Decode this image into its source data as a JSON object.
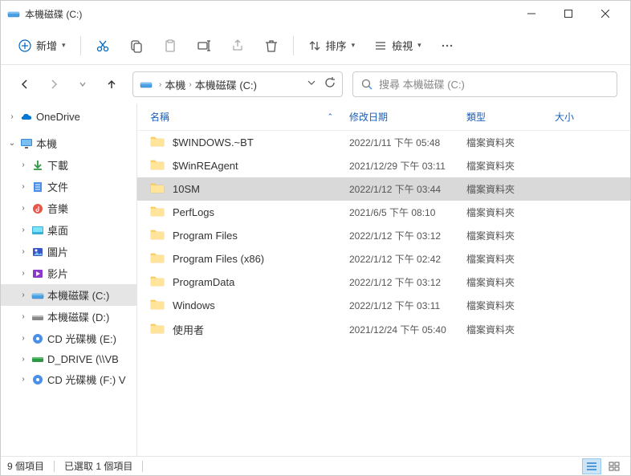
{
  "window": {
    "title": "本機磁碟 (C:)"
  },
  "toolbar": {
    "new": "新增",
    "sort": "排序",
    "view": "檢視"
  },
  "breadcrumb": {
    "items": [
      "本機",
      "本機磁碟 (C:)"
    ]
  },
  "search": {
    "placeholder": "搜尋 本機磁碟 (C:)"
  },
  "sidebar": {
    "onedrive": "OneDrive",
    "thispc": "本機",
    "downloads": "下載",
    "documents": "文件",
    "music": "音樂",
    "desktop": "桌面",
    "pictures": "圖片",
    "videos": "影片",
    "drive_c": "本機磁碟 (C:)",
    "drive_d": "本機磁碟 (D:)",
    "cd_e": "CD 光碟機 (E:)",
    "d_drive": "D_DRIVE (\\\\VB",
    "cd_f": "CD 光碟機 (F:) V"
  },
  "columns": {
    "name": "名稱",
    "date": "修改日期",
    "type": "類型",
    "size": "大小"
  },
  "files": [
    {
      "name": "$WINDOWS.~BT",
      "date": "2022/1/11 下午 05:48",
      "type": "檔案資料夾",
      "selected": false
    },
    {
      "name": "$WinREAgent",
      "date": "2021/12/29 下午 03:11",
      "type": "檔案資料夾",
      "selected": false
    },
    {
      "name": "10SM",
      "date": "2022/1/12 下午 03:44",
      "type": "檔案資料夾",
      "selected": true
    },
    {
      "name": "PerfLogs",
      "date": "2021/6/5 下午 08:10",
      "type": "檔案資料夾",
      "selected": false
    },
    {
      "name": "Program Files",
      "date": "2022/1/12 下午 03:12",
      "type": "檔案資料夾",
      "selected": false
    },
    {
      "name": "Program Files (x86)",
      "date": "2022/1/12 下午 02:42",
      "type": "檔案資料夾",
      "selected": false
    },
    {
      "name": "ProgramData",
      "date": "2022/1/12 下午 03:12",
      "type": "檔案資料夾",
      "selected": false
    },
    {
      "name": "Windows",
      "date": "2022/1/12 下午 03:11",
      "type": "檔案資料夾",
      "selected": false
    },
    {
      "name": "使用者",
      "date": "2021/12/24 下午 05:40",
      "type": "檔案資料夾",
      "selected": false
    }
  ],
  "statusbar": {
    "count": "9 個項目",
    "selected": "已選取 1 個項目"
  }
}
